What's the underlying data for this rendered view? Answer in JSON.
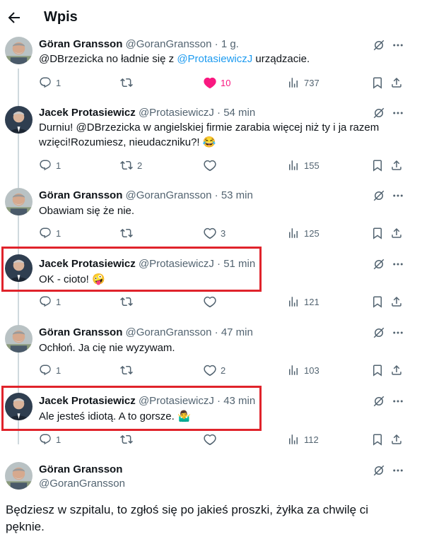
{
  "header": {
    "title": "Wpis"
  },
  "tweets": [
    {
      "name": "Göran Gransson",
      "handle": "@GoranGransson",
      "time": "1 g.",
      "text_parts": [
        "@DBrzezicka no ładnie się z ",
        "@ProtasiewiczJ",
        " urządzacie."
      ],
      "replies": "1",
      "retweets": "",
      "likes": "10",
      "views": "737",
      "liked": true
    },
    {
      "name": "Jacek Protasiewicz",
      "handle": "@ProtasiewiczJ",
      "time": "54 min",
      "text_line1": "Durniu! @DBrzezicka w  angielskiej firmie zarabia więcej niż ty i ja razem",
      "text_line2": "wzięci!Rozumiesz, nieudaczniku?! 😂",
      "replies": "1",
      "retweets": "2",
      "likes": "",
      "views": "155"
    },
    {
      "name": "Göran Gransson",
      "handle": "@GoranGransson",
      "time": "53 min",
      "text": "Obawiam się że nie.",
      "replies": "1",
      "retweets": "",
      "likes": "3",
      "views": "125"
    },
    {
      "name": "Jacek Protasiewicz",
      "handle": "@ProtasiewiczJ",
      "time": "51 min",
      "text": "OK - cioto! 🤪",
      "replies": "1",
      "retweets": "",
      "likes": "",
      "views": "121"
    },
    {
      "name": "Göran Gransson",
      "handle": "@GoranGransson",
      "time": "47 min",
      "text": "Ochłoń. Ja cię nie wyzywam.",
      "replies": "1",
      "retweets": "",
      "likes": "2",
      "views": "103"
    },
    {
      "name": "Jacek Protasiewicz",
      "handle": "@ProtasiewiczJ",
      "time": "43 min",
      "text": "Ale jesteś idiotą. A to gorsze. 🤷‍♂️",
      "replies": "1",
      "retweets": "",
      "likes": "",
      "views": "112"
    }
  ],
  "main_tweet": {
    "name": "Göran Gransson",
    "handle": "@GoranGransson",
    "text_line1": "Będziesz w szpitalu, to zgłoś się po jakieś proszki, żyłka za chwilę ci",
    "text_line2": "pęknie."
  },
  "dot": "·",
  "icons": [
    "back-arrow-icon",
    "reply-icon",
    "retweet-icon",
    "like-icon",
    "views-icon",
    "bookmark-icon",
    "share-icon",
    "grok-icon",
    "more-icon"
  ],
  "colors": {
    "accent": "#1d9bf0",
    "like": "#f91880",
    "secondary": "#536471",
    "highlight": "#e0232b"
  }
}
